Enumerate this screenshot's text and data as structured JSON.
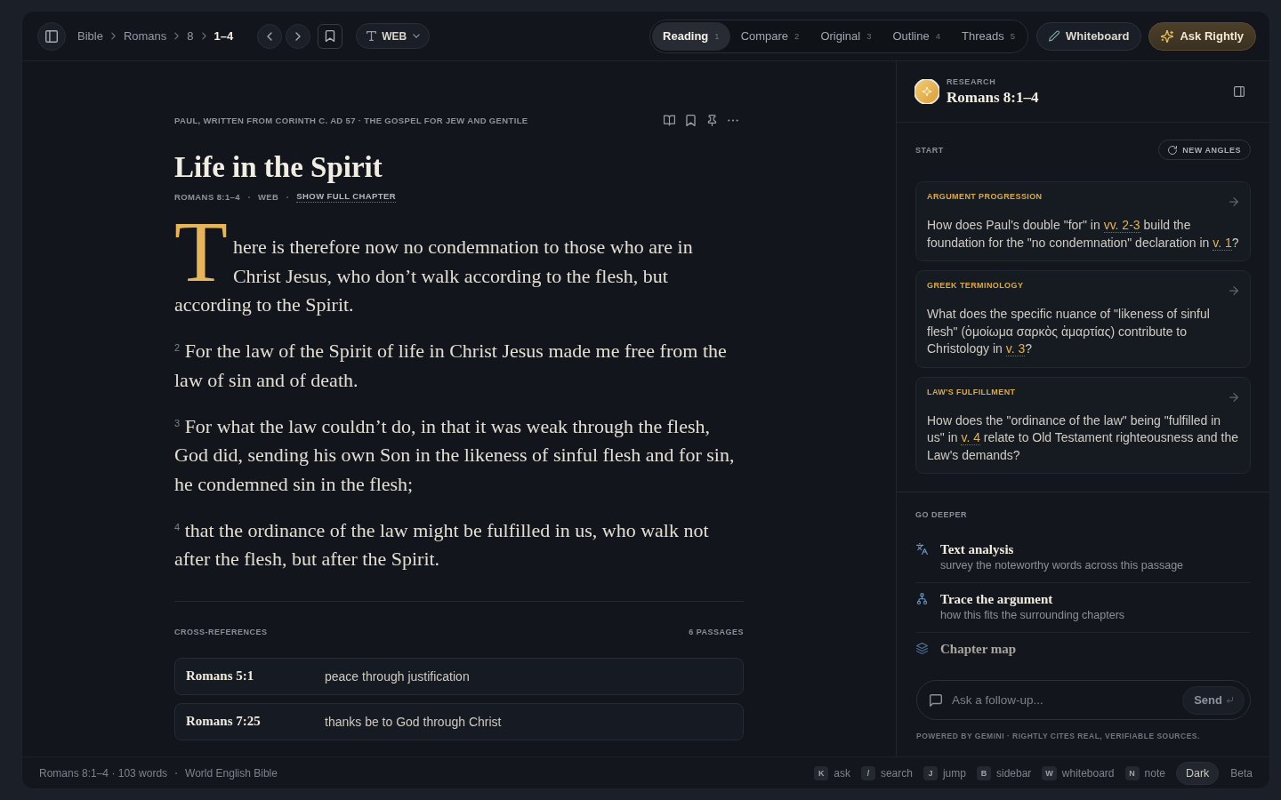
{
  "topbar": {
    "breadcrumb": [
      {
        "label": "Bible",
        "current": false
      },
      {
        "label": "Romans",
        "current": false
      },
      {
        "label": "8",
        "current": false
      },
      {
        "label": "1–4",
        "current": true
      }
    ],
    "translation": "WEB",
    "tabs": [
      {
        "label": "Reading",
        "shortcut": "1",
        "selected": true
      },
      {
        "label": "Compare",
        "shortcut": "2",
        "selected": false
      },
      {
        "label": "Original",
        "shortcut": "3",
        "selected": false
      },
      {
        "label": "Outline",
        "shortcut": "4",
        "selected": false
      },
      {
        "label": "Threads",
        "shortcut": "5",
        "selected": false
      }
    ],
    "whiteboard_button": "Whiteboard",
    "ask_button": "Ask Rightly"
  },
  "reading": {
    "meta": "PAUL, WRITTEN FROM CORINTH C. AD 57 · THE GOSPEL FOR JEW AND GENTILE",
    "title": "Life in the Spirit",
    "subline": [
      "ROMANS 8:1–4",
      "WEB"
    ],
    "chapter_link": "SHOW FULL CHAPTER",
    "verses": [
      {
        "kind": "drop_cap",
        "text": "There is therefore now no condemnation to those who are in Christ Jesus, who don’t walk according to the flesh, but according to the Spirit."
      },
      {
        "kind": "numbered",
        "text": "$^{2}$ For the law of the Spirit of life in Christ Jesus made me free from the law of sin and of death."
      },
      {
        "kind": "numbered",
        "text": "$^{3}$ For what the law couldn’t do, in that it was weak through the flesh, God did, sending his own Son in the likeness of sinful flesh and for sin, he condemned sin in the flesh;"
      },
      {
        "kind": "numbered",
        "text": "$^{4}$ that the ordinance of the law might be fulfilled in us, who walk not after the flesh, but after the Spirit."
      }
    ],
    "cross_references": {
      "title": "CROSS-REFERENCES",
      "count": "6 PASSAGES",
      "rows": [
        {
          "ref": "Romans 5:1",
          "summary": "peace through justification"
        },
        {
          "ref": "Romans 7:25",
          "summary": "thanks be to God through Christ"
        }
      ]
    }
  },
  "research": {
    "eyebrow": "RESEARCH",
    "title": "Romans 8:1–4",
    "start_label": "START",
    "new_angles_button": "NEW ANGLES",
    "cards": [
      {
        "category": "ARGUMENT PROGRESSION",
        "question": [
          {
            "kind": "text",
            "text": "How does Paul's double \"for\" in "
          },
          {
            "kind": "ref",
            "text": "vv. 2-3"
          },
          {
            "kind": "text",
            "text": " build the foundation for the \"no condemnation\" declaration in "
          },
          {
            "kind": "ref",
            "text": "v. 1"
          },
          {
            "kind": "text",
            "text": "?"
          }
        ]
      },
      {
        "category": "GREEK TERMINOLOGY",
        "question": [
          {
            "kind": "text",
            "text": "What does the specific nuance of \"likeness of sinful flesh\" (ὁμοίωμα σαρκὸς ἁμαρτίας) contribute to Christology in "
          },
          {
            "kind": "ref",
            "text": "v. 3"
          },
          {
            "kind": "text",
            "text": "?"
          }
        ]
      },
      {
        "category": "LAW'S FULFILLMENT",
        "question": [
          {
            "kind": "text",
            "text": "How does the \"ordinance of the law\" being \"fulfilled in us\" in "
          },
          {
            "kind": "ref",
            "text": "v. 4"
          },
          {
            "kind": "text",
            "text": " relate to Old Testament righteousness and the Law's demands?"
          }
        ]
      }
    ],
    "go_deeper": {
      "label": "GO DEEPER",
      "items": [
        {
          "kind": "language",
          "title": "Text analysis",
          "subtitle": "survey the noteworthy words across this passage"
        },
        {
          "kind": "structure",
          "title": "Trace the argument",
          "subtitle": "how this fits the surrounding chapters"
        },
        {
          "kind": "layers",
          "title": "Chapter map"
        }
      ]
    },
    "follow_up": {
      "placeholder": "Ask a follow-up...",
      "send_button": "Send"
    },
    "footer": "POWERED BY GEMINI · RIGHTLY CITES REAL, VERIFIABLE SOURCES."
  },
  "status_bar": {
    "passage": "Romans 8:1–4 · 103 words",
    "translation": "World English Bible",
    "shortcuts": [
      {
        "key": "K",
        "label": "ask"
      },
      {
        "key": "/",
        "label": "search"
      },
      {
        "key": "J",
        "label": "jump"
      },
      {
        "key": "B",
        "label": "sidebar"
      },
      {
        "key": "W",
        "label": "whiteboard"
      },
      {
        "key": "N",
        "label": "note"
      }
    ],
    "theme_button": "Dark",
    "badge": "Beta"
  }
}
